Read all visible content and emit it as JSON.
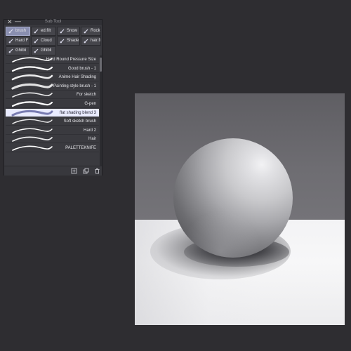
{
  "panel": {
    "title": "Sub Tool",
    "close_glyph": "✕",
    "minimize_glyph": "—",
    "tabs": [
      {
        "label": "brush",
        "icon": "brush-icon",
        "active": true
      },
      {
        "label": "ed.filt",
        "icon": "brush-icon",
        "active": false
      },
      {
        "label": "Snow",
        "icon": "brush-icon",
        "active": false
      },
      {
        "label": "Rock",
        "icon": "brush-icon",
        "active": false
      },
      {
        "label": "Hard F",
        "icon": "brush-icon",
        "active": false
      },
      {
        "label": "Cloud",
        "icon": "brush-icon",
        "active": false
      },
      {
        "label": "Shade",
        "icon": "brush-icon",
        "active": false
      },
      {
        "label": "hair.fi",
        "icon": "brush-icon",
        "active": false
      },
      {
        "label": "Ghibli",
        "icon": "brush-icon",
        "active": false
      },
      {
        "label": "Ghibli",
        "icon": "brush-icon",
        "active": false
      }
    ],
    "brushes": [
      {
        "name": "Hard Round Pressure Size",
        "selected": false
      },
      {
        "name": "Good brush - 1",
        "selected": false
      },
      {
        "name": "Anime Hair Shading",
        "selected": false
      },
      {
        "name": "Painting style brush - 1",
        "selected": false
      },
      {
        "name": "For sketch",
        "selected": false
      },
      {
        "name": "G-pen",
        "selected": false
      },
      {
        "name": "flat shading blend 3",
        "selected": true
      },
      {
        "name": "Soft sketch brush",
        "selected": false
      },
      {
        "name": "Hard 2",
        "selected": false
      },
      {
        "name": "Hair",
        "selected": false
      },
      {
        "name": "PALETTEKNIFE",
        "selected": false
      }
    ],
    "footer_buttons": [
      {
        "name": "create-copy-icon"
      },
      {
        "name": "duplicate-icon"
      },
      {
        "name": "trash-icon"
      }
    ]
  },
  "colors": {
    "background": "#2e2d31",
    "panel": "#3a3a3f",
    "active_tab": "#8a8fb0",
    "selected_row": "#e9ebff"
  }
}
